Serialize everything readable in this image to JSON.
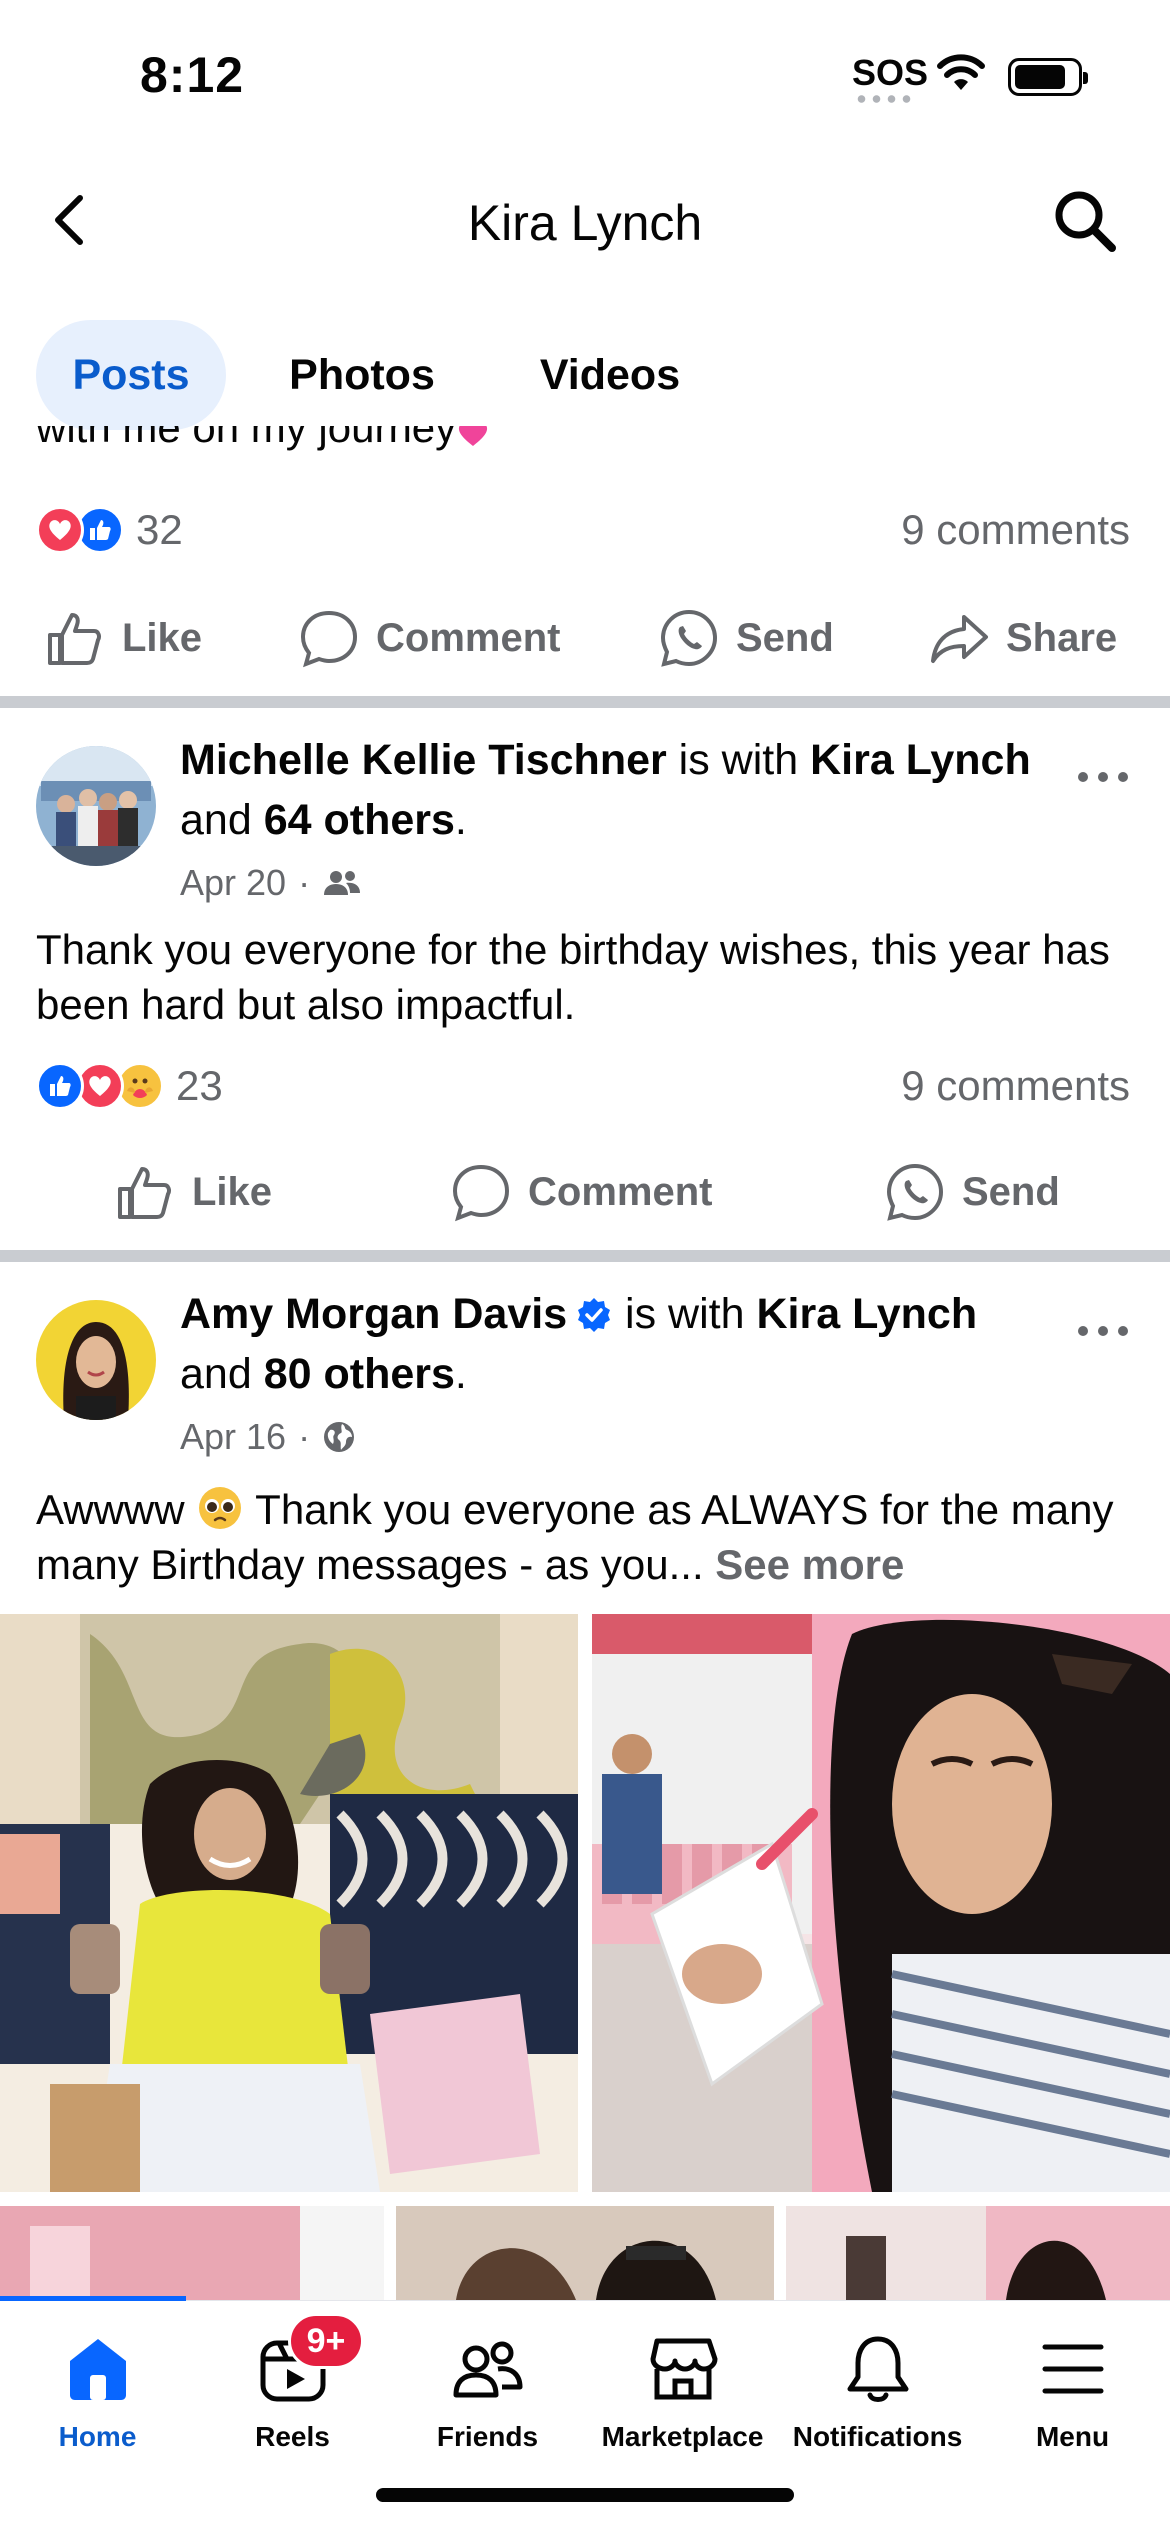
{
  "status_bar": {
    "time": "8:12",
    "sos": "SOS"
  },
  "header": {
    "title": "Kira Lynch"
  },
  "tabs": [
    {
      "label": "Posts",
      "active": true
    },
    {
      "label": "Photos",
      "active": false
    },
    {
      "label": "Videos",
      "active": false
    }
  ],
  "post1": {
    "text_tail": "with me on my journey",
    "reaction_count": "32",
    "comments": "9 comments",
    "actions": {
      "like": "Like",
      "comment": "Comment",
      "send": "Send",
      "share": "Share"
    }
  },
  "post2": {
    "author": "Michelle Kellie Tischner",
    "with_text": " is with ",
    "tagged": "Kira Lynch",
    "and_text": " and ",
    "others": "64 others",
    "period": ".",
    "date": "Apr 20",
    "audience_icon": "friends-icon",
    "text": "Thank you everyone for the birthday wishes, this year has been hard but also impactful.",
    "reaction_count": "23",
    "comments": "9 comments",
    "actions": {
      "like": "Like",
      "comment": "Comment",
      "send": "Send"
    }
  },
  "post3": {
    "author": "Amy Morgan Davis",
    "with_text": " is with ",
    "tagged": "Kira Lynch",
    "and_text": "and ",
    "others": "80 others",
    "period": ".",
    "date": "Apr 16",
    "audience_icon": "globe-icon",
    "text_a": "Awwww ",
    "text_b": " Thank you everyone as ALWAYS for the many many Birthday messages - as you... ",
    "see_more": "See more"
  },
  "bottom_nav": {
    "items": [
      {
        "label": "Home",
        "icon": "home-icon",
        "active": true
      },
      {
        "label": "Reels",
        "icon": "reels-icon",
        "active": false
      },
      {
        "label": "Friends",
        "icon": "friends-icon",
        "active": false
      },
      {
        "label": "Marketplace",
        "icon": "marketplace-icon",
        "active": false
      },
      {
        "label": "Notifications",
        "icon": "bell-icon",
        "active": false
      },
      {
        "label": "Menu",
        "icon": "menu-icon",
        "active": false
      }
    ],
    "reels_badge": "9+"
  },
  "colors": {
    "accent": "#0a5ccc",
    "like_blue": "#0866ff",
    "love_red": "#f33e58",
    "badge_red": "#e41e3f",
    "muted": "#65676b"
  }
}
